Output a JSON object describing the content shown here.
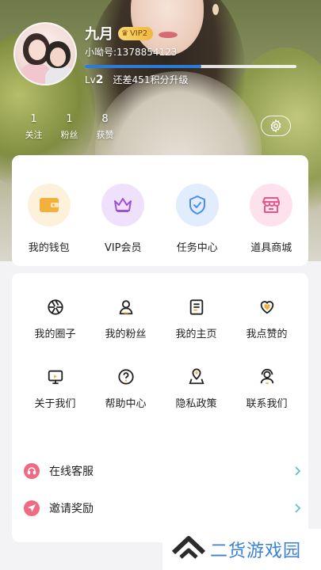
{
  "profile": {
    "username": "九月",
    "vip_badge": "VIP2",
    "account": "小呦号:1378854123",
    "level_prefix": "Lv",
    "level_number": "2",
    "level_hint": "还差451积分升级",
    "level_progress_fraction": 0.55
  },
  "stats": [
    {
      "count": "1",
      "label": "关注"
    },
    {
      "count": "1",
      "label": "粉丝"
    },
    {
      "count": "8",
      "label": "获赞"
    }
  ],
  "settings_icon": "gear-icon",
  "quick_actions": [
    {
      "label": "我的钱包",
      "icon": "wallet-icon",
      "color": "#f2b13e",
      "bg": "#fdf1dc"
    },
    {
      "label": "VIP会员",
      "icon": "crown-icon",
      "color": "#9b52d9",
      "bg": "#efe1fb"
    },
    {
      "label": "任务中心",
      "icon": "shield-check-icon",
      "color": "#4a8df0",
      "bg": "#e1ecfd"
    },
    {
      "label": "道具商城",
      "icon": "store-icon",
      "color": "#e8568a",
      "bg": "#fde1ec"
    }
  ],
  "menu_row1": [
    {
      "label": "我的圈子",
      "icon": "aperture-icon"
    },
    {
      "label": "我的粉丝",
      "icon": "person-icon"
    },
    {
      "label": "我的主页",
      "icon": "document-icon"
    },
    {
      "label": "我点赞的",
      "icon": "heart-icon"
    }
  ],
  "menu_row2": [
    {
      "label": "关于我们",
      "icon": "monitor-icon"
    },
    {
      "label": "帮助中心",
      "icon": "question-icon"
    },
    {
      "label": "隐私政策",
      "icon": "location-icon"
    },
    {
      "label": "联系我们",
      "icon": "contact-icon"
    }
  ],
  "list": [
    {
      "label": "在线客服",
      "icon": "headset-icon",
      "color": "#ef6a83"
    },
    {
      "label": "邀请奖励",
      "icon": "send-icon",
      "color": "#ef6a83"
    }
  ],
  "watermark": {
    "text": "二货游戏园",
    "color": "#3a82d6"
  }
}
